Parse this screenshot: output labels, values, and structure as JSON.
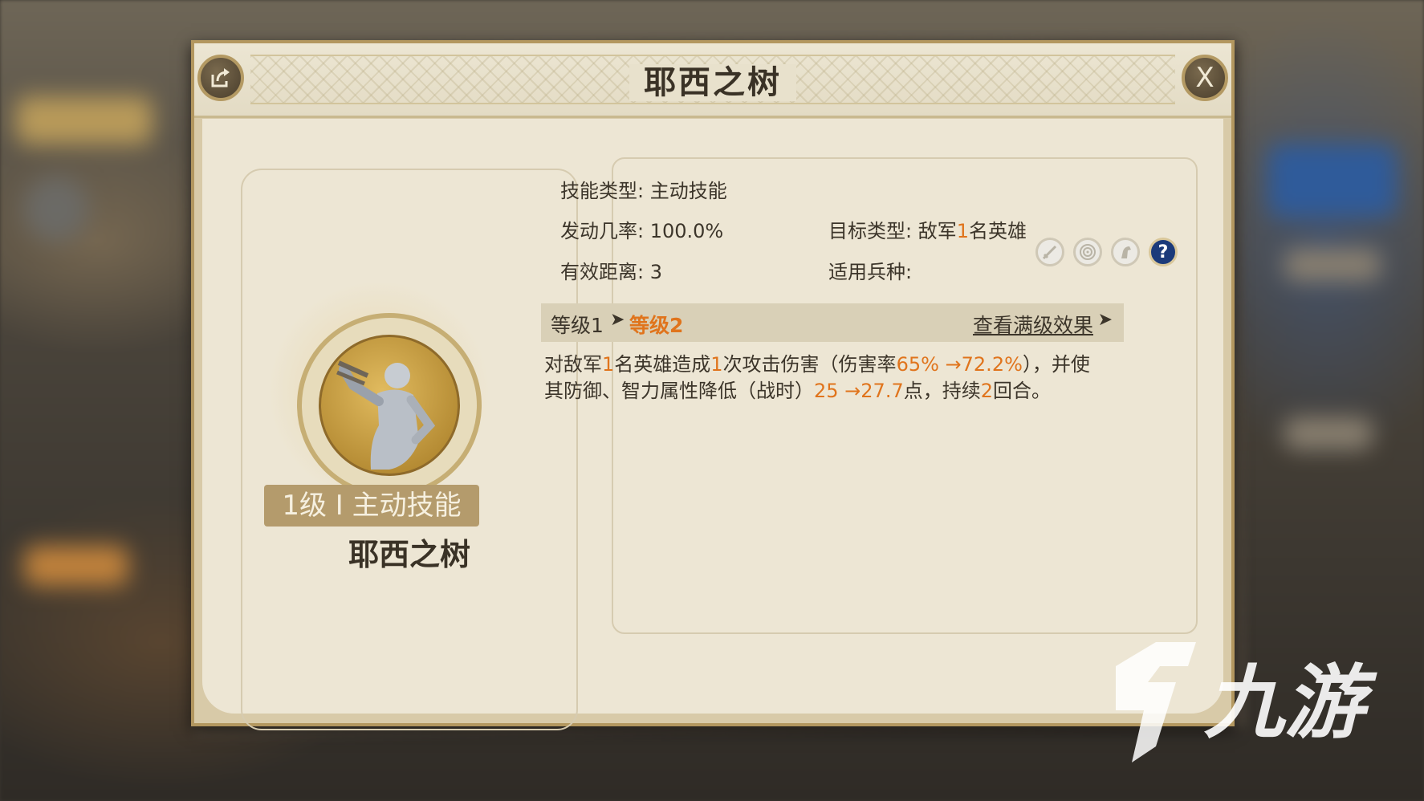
{
  "dialog": {
    "title": "耶西之树",
    "close_label": "X"
  },
  "skill": {
    "badge": "1级 I 主动技能",
    "name": "耶西之树"
  },
  "info": {
    "skill_type": "技能类型: 主动技能",
    "trigger_rate": "发动几率: 100.0%",
    "target_type_label": "目标类型: 敌军",
    "target_count": "1",
    "target_suffix": "名英雄",
    "range": "有效距离: 3",
    "unit_types_label": "适用兵种:",
    "unit_icons": [
      "sword-icon",
      "target-icon",
      "horse-icon",
      "question-icon"
    ]
  },
  "levels": {
    "current": "等级1",
    "next": "等级2",
    "view_full": "查看满级效果"
  },
  "description": {
    "p1": "对敌军",
    "n1": "1",
    "p2": "名英雄造成",
    "n2": "1",
    "p3": "次攻击伤害（伤害率",
    "n3": "65% →72.2%",
    "p4": "），并使其防御、智力属性降低（战时）",
    "n4": "25 →27.7",
    "p5": "点，持续",
    "n5": "2",
    "p6": "回合。"
  },
  "colors": {
    "highlight": "#e0741c",
    "panel": "#ede6d4",
    "frame": "#b3975f"
  }
}
